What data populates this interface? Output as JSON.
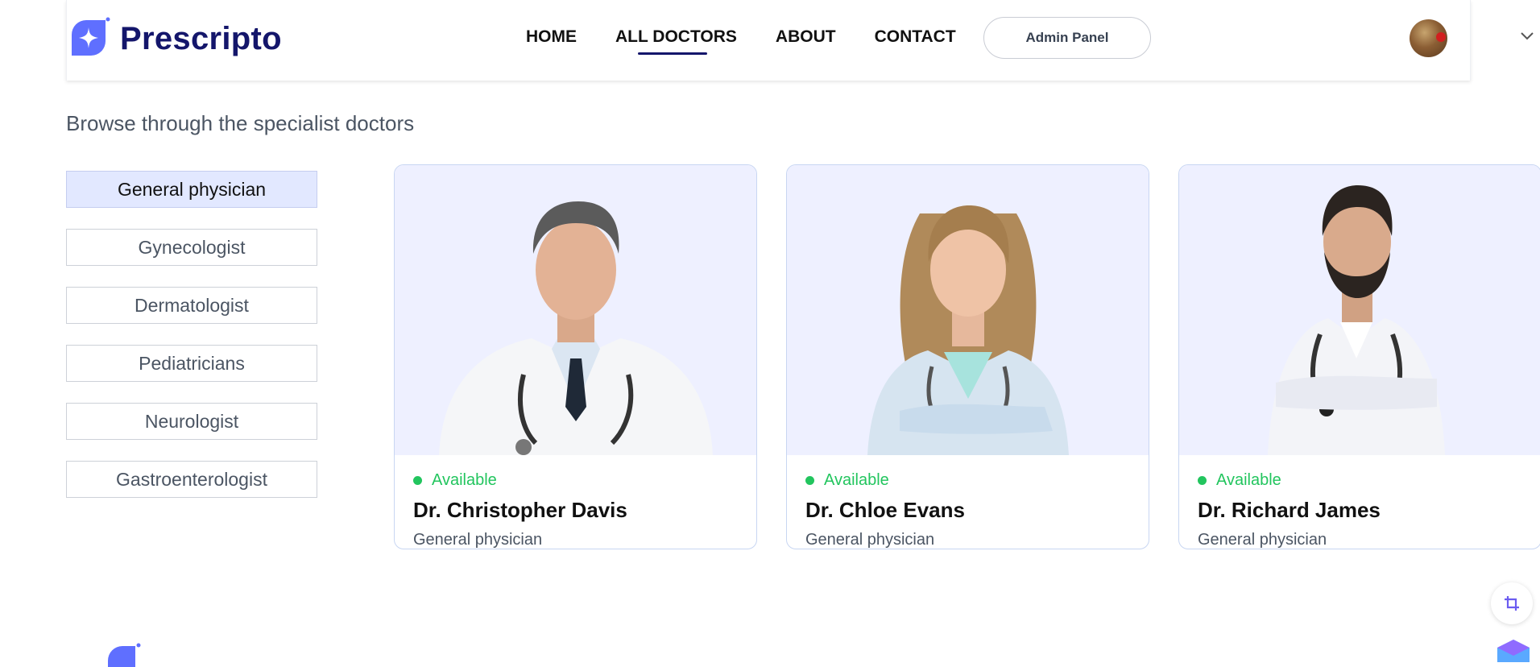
{
  "brand": {
    "name": "Prescripto",
    "color": "#5f6fff",
    "text_color": "#14166b"
  },
  "nav": {
    "items": [
      {
        "label": "HOME"
      },
      {
        "label": "ALL DOCTORS"
      },
      {
        "label": "ABOUT"
      },
      {
        "label": "CONTACT"
      }
    ],
    "active": "ALL DOCTORS",
    "admin_button": "Admin Panel",
    "avatar_icon": "user-avatar",
    "dropdown_icon": "chevron-down-icon"
  },
  "page": {
    "subtitle": "Browse through the specialist doctors"
  },
  "categories": [
    {
      "label": "General physician"
    },
    {
      "label": "Gynecologist"
    },
    {
      "label": "Dermatologist"
    },
    {
      "label": "Pediatricians"
    },
    {
      "label": "Neurologist"
    },
    {
      "label": "Gastroenterologist"
    }
  ],
  "active_category": "General physician",
  "doctors": [
    {
      "status": "Available",
      "name": "Dr. Christopher Davis",
      "speciality": "General physician"
    },
    {
      "status": "Available",
      "name": "Dr. Chloe Evans",
      "speciality": "General physician"
    },
    {
      "status": "Available",
      "name": "Dr. Richard James",
      "speciality": "General physician"
    }
  ],
  "colors": {
    "available": "#22c55e",
    "card_bg": "#eef0ff",
    "active_category_bg": "#e2e8ff"
  }
}
